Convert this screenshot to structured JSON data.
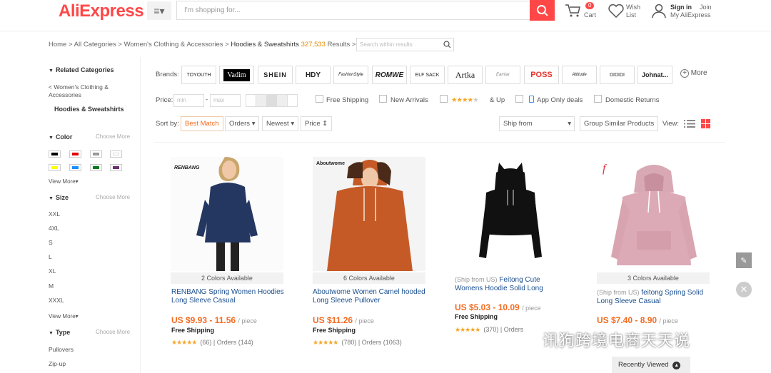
{
  "header": {
    "logo": "AliExpress",
    "search_placeholder": "I'm shopping for...",
    "cart_label": "Cart",
    "cart_count": "0",
    "wish_line1": "Wish",
    "wish_line2": "List",
    "signin": "Sign in",
    "join": "Join",
    "my_ali": "My AliExpress"
  },
  "breadcrumb": {
    "path": "Home > All Categories > Women's Clothing & Accessories > ",
    "current": "Hoodies & Sweatshirts",
    "count": "327,533",
    "results_label": "Results >",
    "inner_search_placeholder": "Search within results"
  },
  "sidebar": {
    "related_title": "Related Categories",
    "parent_link": "< Women's Clothing & Accessories",
    "current_cat": "Hoodies & Sweatshirts",
    "color_title": "Color",
    "choose_more": "Choose More",
    "view_more": "View More",
    "size_title": "Size",
    "sizes": [
      "XXL",
      "4XL",
      "S",
      "L",
      "XL",
      "M",
      "XXXL"
    ],
    "type_title": "Type",
    "types": [
      "Pullovers",
      "Zip-up"
    ],
    "swatch_colors": [
      "#000000",
      "#e60000",
      "#999999",
      "#ffffff",
      "#ffff00",
      "#1a8cff",
      "#007a1f",
      "#6b3070"
    ]
  },
  "filters": {
    "brands_label": "Brands:",
    "brands": [
      "TOYOUTH",
      "Vadim",
      "SHEIN",
      "HDY",
      "FashionStyle",
      "ROMWE",
      "ELF SACK",
      "Artka",
      "Eamiar",
      "POSS",
      "Attitude",
      "DIDIDI",
      "Johnat..."
    ],
    "brands_more": "More",
    "price_label": "Price:",
    "price_min": "min",
    "price_dash": "-",
    "price_max": "max",
    "free_shipping": "Free Shipping",
    "new_arrivals": "New Arrivals",
    "stars_up": "& Up",
    "app_only": "App Only deals",
    "domestic": "Domestic Returns",
    "sort_label": "Sort by:",
    "sort_best": "Best Match",
    "sort_orders": "Orders",
    "sort_newest": "Newest",
    "sort_price": "Price",
    "ship_from": "Ship from",
    "group_similar": "Group Similar Products",
    "view_label": "View:"
  },
  "products": [
    {
      "brand_tag": "RENBANG",
      "colors": "2 Colors Available",
      "ship_prefix": "",
      "title": "RENBANG Spring Women Hoodies Long Sleeve Casual",
      "price": "US $9.93 - 11.56",
      "unit": "/ piece",
      "free": "Free Shipping",
      "stars": "★★★★★",
      "reviews": "(66)",
      "orders": "Orders (144)"
    },
    {
      "brand_tag": "Aboutwome",
      "colors": "6 Colors Available",
      "ship_prefix": "",
      "title": "Aboutwome Women Camel hooded Long Sleeve Pullover",
      "price": "US $11.26",
      "unit": "/ piece",
      "free": "Free Shipping",
      "stars": "★★★★★",
      "reviews": "(780)",
      "orders": "Orders (1063)"
    },
    {
      "brand_tag": "",
      "colors": "",
      "ship_prefix": "(Ship from US)",
      "title": "Feitong Cute Womens Hoodie Solid Long",
      "price": "US $5.03 - 10.09",
      "unit": "/ piece",
      "free": "Free Shipping",
      "stars": "★★★★★",
      "reviews": "(370)",
      "orders": "Orders"
    },
    {
      "brand_tag": "f",
      "colors": "3 Colors Available",
      "ship_prefix": "(Ship from US)",
      "title": "feitong Spring Solid Long Sleeve Casual",
      "price": "US $7.40 - 8.90",
      "unit": "/ piece",
      "free": "",
      "stars": "",
      "reviews": "",
      "orders": ""
    }
  ],
  "footer": {
    "recently_viewed": "Recently Viewed",
    "watermark": "讯狗跨境电商天天说"
  }
}
